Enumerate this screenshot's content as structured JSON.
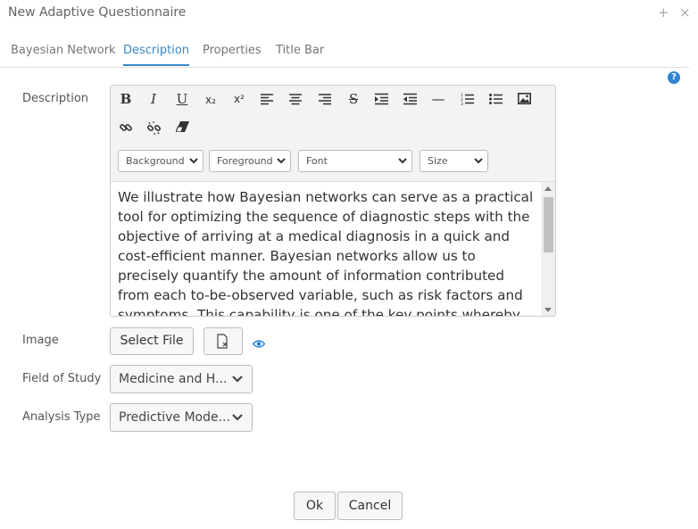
{
  "window": {
    "title": "New Adaptive Questionnaire",
    "plus_icon": "+",
    "close_icon": "×"
  },
  "tabs": [
    {
      "label": "Bayesian Network"
    },
    {
      "label": "Description",
      "active": true
    },
    {
      "label": "Properties"
    },
    {
      "label": "Title Bar"
    }
  ],
  "help_icon": "?",
  "form": {
    "description_label": "Description",
    "image_label": "Image",
    "field_of_study_label": "Field of Study",
    "analysis_type_label": "Analysis Type"
  },
  "toolbar": {
    "bold": "B",
    "italic": "I",
    "underline": "U",
    "subscript": "x₂",
    "superscript": "x²",
    "strike": "S",
    "hr": "—",
    "background_select": "Background",
    "foreground_select": "Foreground",
    "font_select": "Font",
    "size_select": "Size"
  },
  "editor": {
    "content": "We illustrate how Bayesian networks can serve as a practical tool for optimizing the sequence of diagnostic steps with the objective of arriving at a medical diagnosis in a quick and cost-efficient manner. Bayesian networks allow us to precisely quantify the amount of information contributed from each to-be-observed variable, such as risk factors and symptoms. This capability is one of the key points whereby machine-learned"
  },
  "image_field": {
    "select_file_label": "Select File"
  },
  "field_of_study": {
    "value": "Medicine and H..."
  },
  "analysis_type": {
    "value": "Predictive Mode..."
  },
  "footer": {
    "ok_label": "Ok",
    "cancel_label": "Cancel"
  },
  "colors": {
    "accent": "#3a87c8",
    "help": "#2d84d2"
  }
}
